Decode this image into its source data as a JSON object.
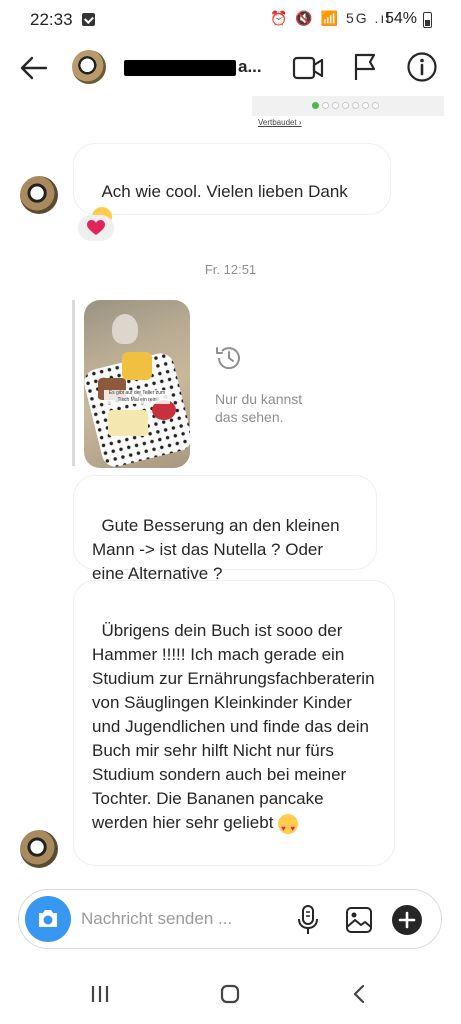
{
  "status_bar": {
    "time": "22:33",
    "icons": "⏰ 🔇 📶 5G .ıl",
    "battery": "54%"
  },
  "header": {
    "name_suffix": "a..."
  },
  "ad_preview": {
    "link": "Vertbaudet ›"
  },
  "messages": {
    "m1": "Ach wie cool. Vielen lieben Dank ",
    "timestamp": "Fr. 12:51",
    "story_caption": "Es gibt auf der Teller zum Tisch Mal ein rein",
    "story_note": "Nur du kannst das sehen.",
    "m2": "Gute Besserung an den kleinen Mann -> ist das Nutella ? Oder eine Alternative ?",
    "m3": "Übrigens dein Buch ist sooo der Hammer !!!!! Ich mach gerade ein Studium zur Ernährungsfachberaterin von Säuglingen Kleinkinder Kinder und Jugendlichen und finde das dein Buch mir sehr hilft Nicht nur fürs Studium sondern auch bei meiner Tochter. Die Bananen pancake werden hier sehr geliebt "
  },
  "reaction": "❤️",
  "composer": {
    "placeholder": "Nachricht senden ..."
  },
  "colors": {
    "accent": "#3897f0",
    "heart": "#e0245e",
    "muted": "#8e8e8e"
  }
}
